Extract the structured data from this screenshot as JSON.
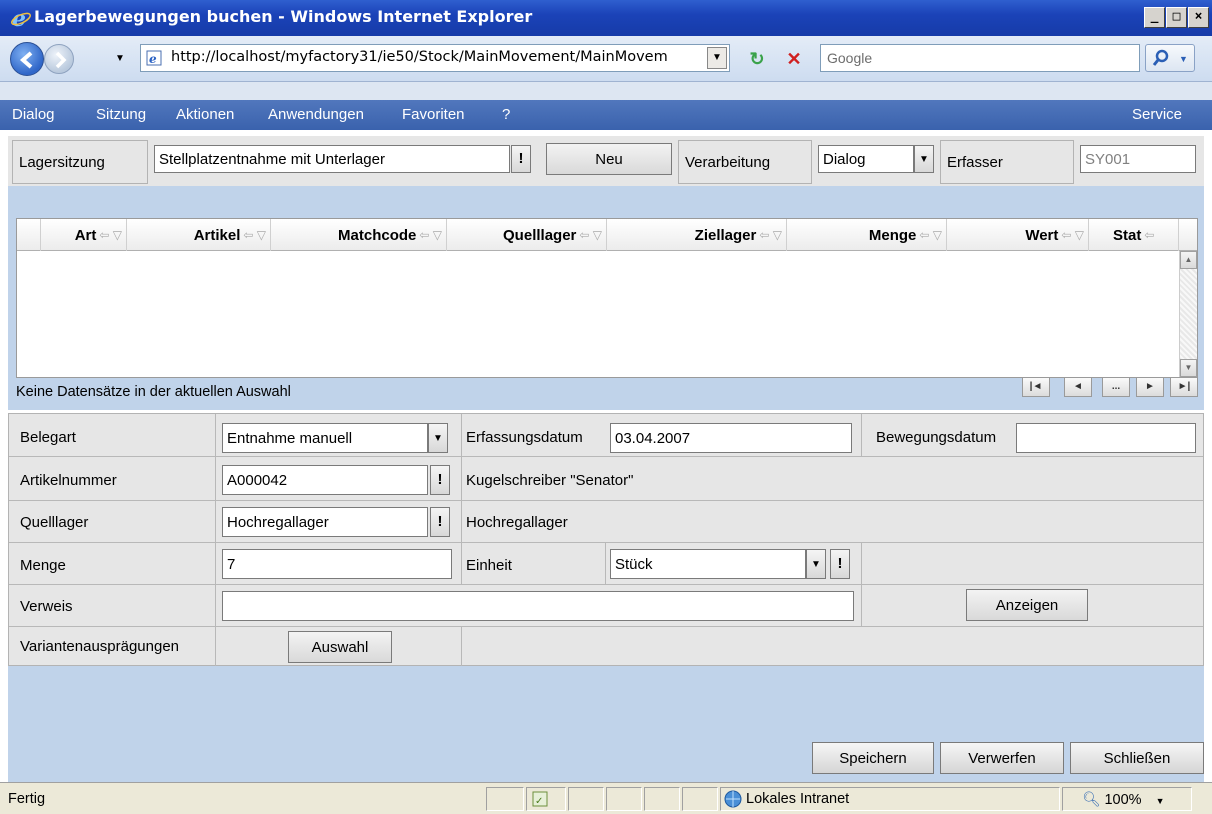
{
  "window": {
    "title": "Lagerbewegungen buchen - Windows Internet Explorer",
    "controls": {
      "minimize": "_",
      "maximize": "□",
      "close": "×"
    }
  },
  "addressbar": {
    "url": "http://localhost/myfactory31/ie50/Stock/MainMovement/MainMovem",
    "search_placeholder": "Google"
  },
  "menu": {
    "items": [
      "Dialog",
      "Sitzung",
      "Aktionen",
      "Anwendungen",
      "Favoriten",
      "?"
    ],
    "right_item": "Service"
  },
  "session": {
    "label": "Lagersitzung",
    "value": "Stellplatzentnahme mit Unterlager",
    "new_button": "Neu",
    "processing_label": "Verarbeitung",
    "processing_value": "Dialog",
    "recorder_label": "Erfasser",
    "recorder_value": "SY001"
  },
  "grid": {
    "columns": [
      "Art",
      "Artikel",
      "Matchcode",
      "Quelllager",
      "Ziellager",
      "Menge",
      "Wert",
      "Stat"
    ],
    "rows": [],
    "empty_message": "Keine Datensätze in der aktuellen Auswahl",
    "pager": [
      "|◄",
      "◄",
      "...",
      "►",
      "►|"
    ]
  },
  "form": {
    "belegart_label": "Belegart",
    "belegart_value": "Entnahme manuell",
    "erfassungsdatum_label": "Erfassungsdatum",
    "erfassungsdatum_value": "03.04.2007",
    "bewegungsdatum_label": "Bewegungsdatum",
    "bewegungsdatum_value": "",
    "artikelnummer_label": "Artikelnummer",
    "artikelnummer_value": "A000042",
    "artikel_name": "Kugelschreiber \"Senator\"",
    "quelllager_label": "Quelllager",
    "quelllager_value": "Hochregallager",
    "quelllager_name": "Hochregallager",
    "menge_label": "Menge",
    "menge_value": "7",
    "einheit_label": "Einheit",
    "einheit_value": "Stück",
    "verweis_label": "Verweis",
    "verweis_value": "",
    "anzeigen_button": "Anzeigen",
    "varianten_label": "Variantenausprägungen",
    "auswahl_button": "Auswahl"
  },
  "actions": {
    "save": "Speichern",
    "discard": "Verwerfen",
    "close": "Schließen"
  },
  "statusbar": {
    "status": "Fertig",
    "zone": "Lokales Intranet",
    "zoom": "100%"
  }
}
